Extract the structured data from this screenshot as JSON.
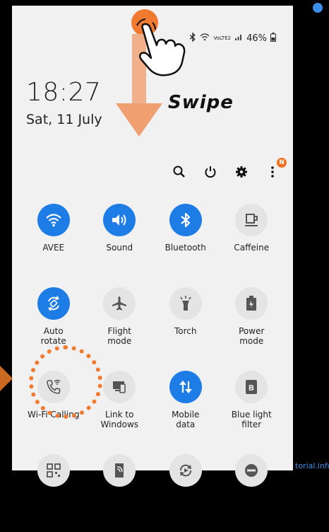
{
  "status": {
    "signal_text": "VoLTE2",
    "battery": "46%"
  },
  "lockscreen": {
    "time": "18:27",
    "date": "Sat, 11 July"
  },
  "annotation": {
    "swipe": "Swipe",
    "watermark": "torial.info"
  },
  "toolbar": {
    "notification_badge": "N"
  },
  "tiles": [
    {
      "label": "AVEE",
      "icon": "wifi-icon",
      "on": true
    },
    {
      "label": "Sound",
      "icon": "sound-icon",
      "on": true
    },
    {
      "label": "Bluetooth",
      "icon": "bluetooth-icon",
      "on": true
    },
    {
      "label": "Caffeine",
      "icon": "cup-icon",
      "on": false
    },
    {
      "label": "Auto\nrotate",
      "icon": "rotate-icon",
      "on": true
    },
    {
      "label": "Flight\nmode",
      "icon": "airplane-icon",
      "on": false
    },
    {
      "label": "Torch",
      "icon": "torch-icon",
      "on": false
    },
    {
      "label": "Power\nmode",
      "icon": "battery-icon",
      "on": false
    },
    {
      "label": "Wi-Fi Calling",
      "icon": "wifi-calling-icon",
      "on": false
    },
    {
      "label": "Link to\nWindows",
      "icon": "link-windows-icon",
      "on": false
    },
    {
      "label": "Mobile\ndata",
      "icon": "mobile-data-icon",
      "on": true
    },
    {
      "label": "Blue light\nfilter",
      "icon": "blue-light-icon",
      "on": false
    },
    {
      "label": "",
      "icon": "qr-icon",
      "on": false
    },
    {
      "label": "",
      "icon": "smart-view-icon",
      "on": false
    },
    {
      "label": "",
      "icon": "sync-icon",
      "on": false
    },
    {
      "label": "",
      "icon": "dnd-icon",
      "on": false
    }
  ],
  "colors": {
    "accent": "#1e7ce6",
    "annotation": "#f07a30",
    "background": "#f1f1f1"
  }
}
